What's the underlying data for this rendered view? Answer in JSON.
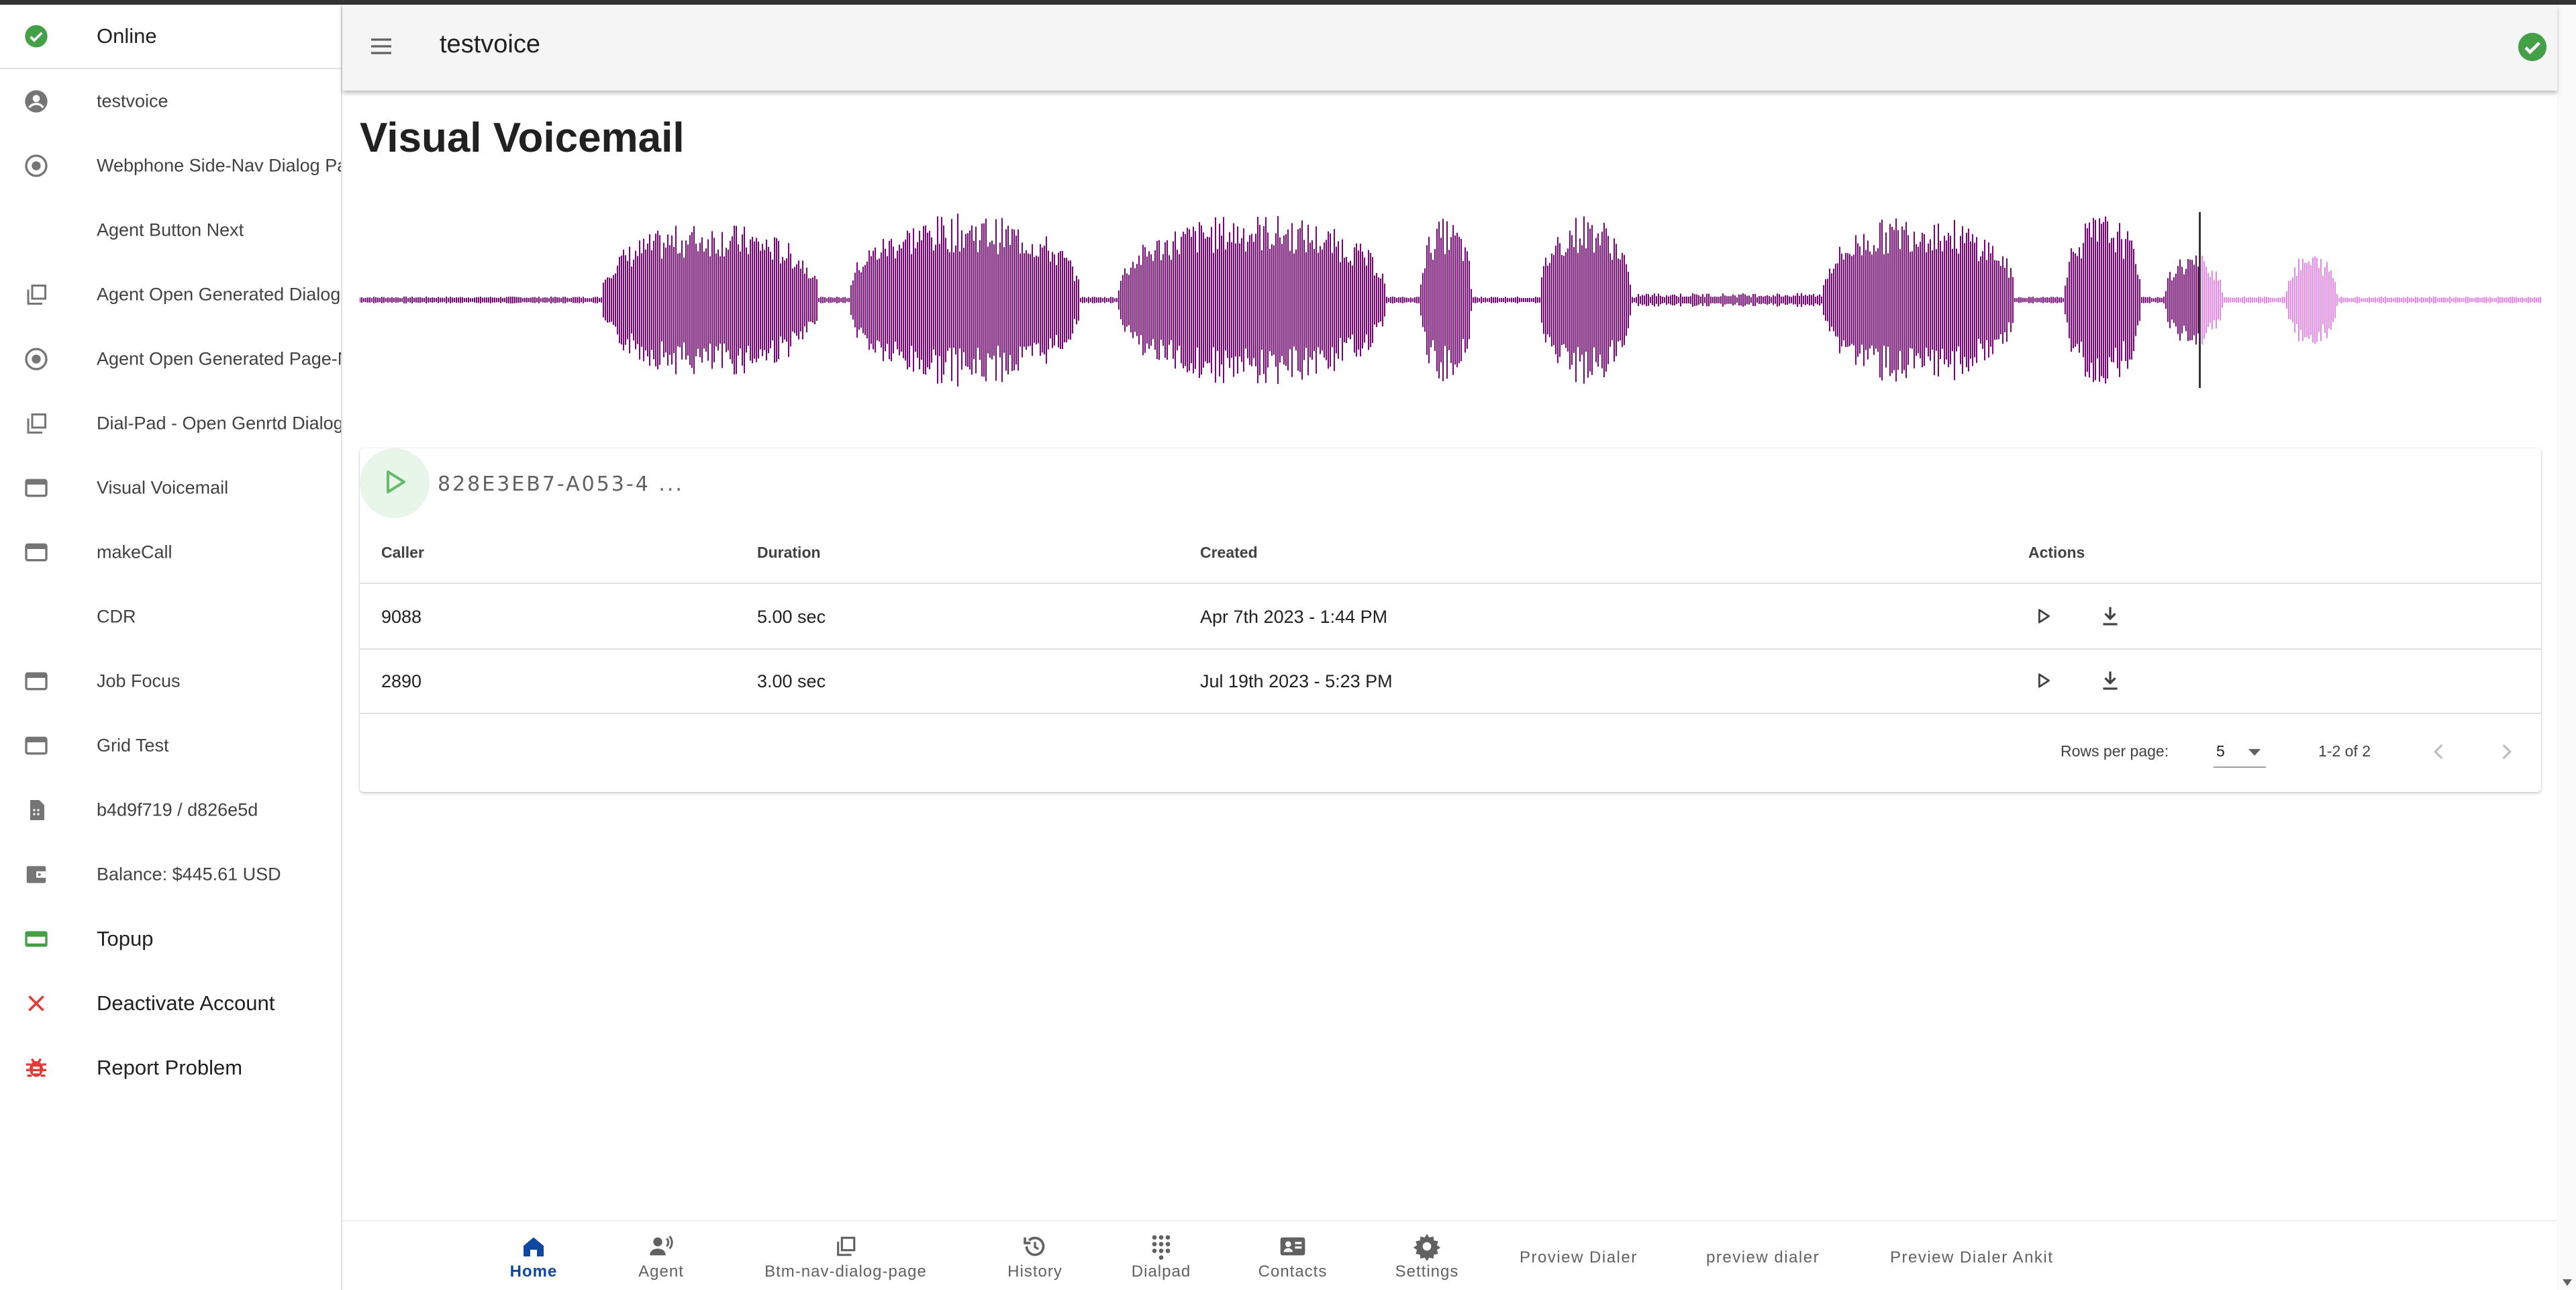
{
  "app": {
    "title": "testvoice",
    "online_status_color": "#43a047"
  },
  "sidebar": {
    "items": [
      {
        "label": "Online",
        "icon": "check-circle-icon"
      },
      {
        "label": "testvoice",
        "icon": "account-circle-icon"
      },
      {
        "label": "Webphone Side-Nav Dialog Page",
        "icon": "radio-button-icon"
      },
      {
        "label": "Agent Button Next",
        "icon": ""
      },
      {
        "label": "Agent Open Generated Dialog",
        "icon": "filter-none-icon"
      },
      {
        "label": "Agent Open Generated Page-Nav",
        "icon": "radio-button-icon"
      },
      {
        "label": "Dial-Pad - Open Genrtd Dialog",
        "icon": "filter-none-icon"
      },
      {
        "label": "Visual Voicemail",
        "icon": "web-asset-icon"
      },
      {
        "label": "makeCall",
        "icon": "web-asset-icon"
      },
      {
        "label": "CDR",
        "icon": ""
      },
      {
        "label": "Job Focus",
        "icon": "web-asset-icon"
      },
      {
        "label": "Grid Test",
        "icon": "web-asset-icon"
      },
      {
        "label": "b4d9f719 / d826e5d",
        "icon": "sim-card-icon"
      },
      {
        "label": "Balance: $445.61 USD",
        "icon": "wallet-icon"
      },
      {
        "label": "Topup",
        "icon": "credit-card-icon"
      },
      {
        "label": "Deactivate Account",
        "icon": "close-icon"
      },
      {
        "label": "Report Problem",
        "icon": "bug-icon"
      }
    ]
  },
  "main": {
    "page_title": "Visual Voicemail",
    "waveform_colors": {
      "played": "#800080",
      "unplayed": "#ee82ee"
    },
    "player": {
      "current_id": "828E3EB7-A053-4 ..."
    },
    "table": {
      "columns": [
        "Caller",
        "Duration",
        "Created",
        "Actions"
      ],
      "rows": [
        {
          "caller": "9088",
          "duration": "5.00 sec",
          "created": "Apr 7th 2023 - 1:44 PM"
        },
        {
          "caller": "2890",
          "duration": "3.00 sec",
          "created": "Jul 19th 2023 - 5:23 PM"
        }
      ]
    },
    "pagination": {
      "rows_per_page_label": "Rows per page:",
      "rows_per_page_value": "5",
      "range": "1-2 of 2"
    }
  },
  "bottom_nav": {
    "items": [
      {
        "label": "Home",
        "icon": "home-icon",
        "active": true
      },
      {
        "label": "Agent",
        "icon": "agent-icon"
      },
      {
        "label": "Btm-nav-dialog-page",
        "icon": "filter-none-icon"
      },
      {
        "label": "History",
        "icon": "history-icon"
      },
      {
        "label": "Dialpad",
        "icon": "dialpad-icon"
      },
      {
        "label": "Contacts",
        "icon": "contacts-icon"
      },
      {
        "label": "Settings",
        "icon": "settings-icon"
      }
    ],
    "text_items": [
      "Proview Dialer",
      "preview dialer",
      "Preview Dialer Ankit"
    ]
  }
}
